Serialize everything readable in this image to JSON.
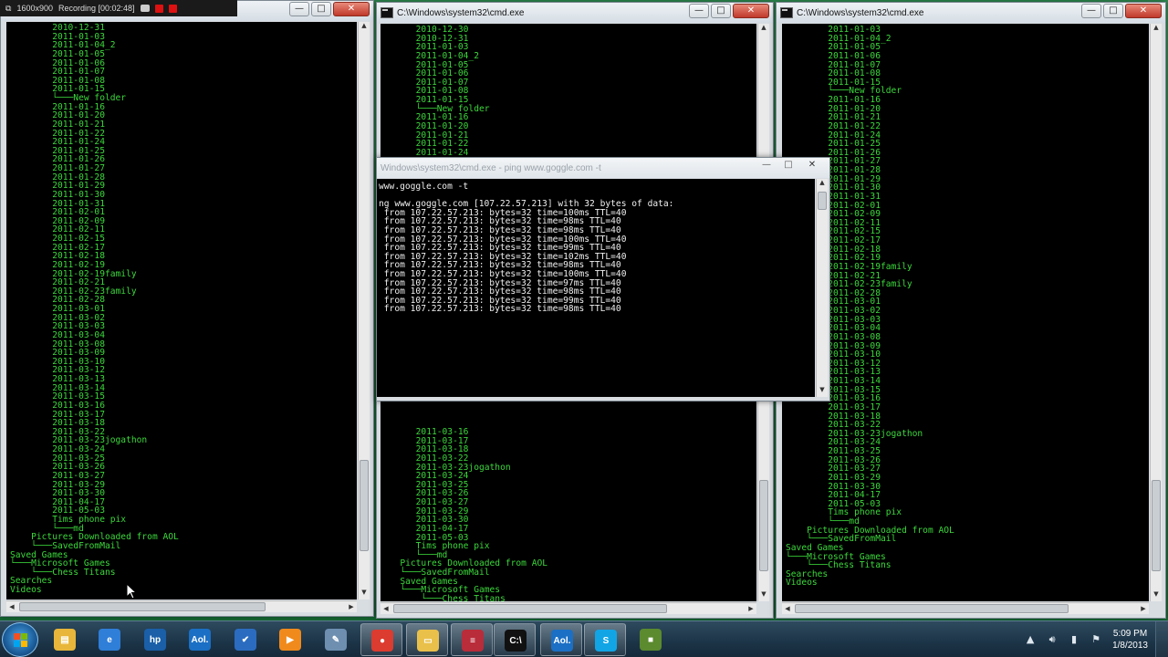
{
  "recording": {
    "resolution": "1600x900",
    "status": "Recording [00:02:48]"
  },
  "windows": {
    "left": {
      "title": "",
      "lines": [
        "        2010-12-31",
        "        2011-01-03",
        "        2011-01-04_2",
        "        2011-01-05",
        "        2011-01-06",
        "        2011-01-07",
        "        2011-01-08",
        "        2011-01-15",
        "        └───New folder",
        "        2011-01-16",
        "        2011-01-20",
        "        2011-01-21",
        "        2011-01-22",
        "        2011-01-24",
        "        2011-01-25",
        "        2011-01-26",
        "        2011-01-27",
        "        2011-01-28",
        "        2011-01-29",
        "        2011-01-30",
        "        2011-01-31",
        "        2011-02-01",
        "        2011-02-09",
        "        2011-02-11",
        "        2011-02-15",
        "        2011-02-17",
        "        2011-02-18",
        "        2011-02-19",
        "        2011-02-19family",
        "        2011-02-21",
        "        2011-02-23family",
        "        2011-02-28",
        "        2011-03-01",
        "        2011-03-02",
        "        2011-03-03",
        "        2011-03-04",
        "        2011-03-08",
        "        2011-03-09",
        "        2011-03-10",
        "        2011-03-12",
        "        2011-03-13",
        "        2011-03-14",
        "        2011-03-15",
        "        2011-03-16",
        "        2011-03-17",
        "        2011-03-18",
        "        2011-03-22",
        "        2011-03-23jogathon",
        "        2011-03-24",
        "        2011-03-25",
        "        2011-03-26",
        "        2011-03-27",
        "        2011-03-29",
        "        2011-03-30",
        "        2011-04-17",
        "        2011-05-03",
        "        Tims phone pix",
        "        └───md",
        "    Pictures Downloaded from AOL",
        "    └───SavedFromMail",
        "Saved Games",
        "└───Microsoft Games",
        "    └───Chess Titans",
        "Searches",
        "Videos"
      ]
    },
    "middle": {
      "title": "C:\\Windows\\system32\\cmd.exe",
      "lines_top": [
        "      2010-12-30",
        "      2010-12-31",
        "      2011-01-03",
        "      2011-01-04_2",
        "      2011-01-05",
        "      2011-01-06",
        "      2011-01-07",
        "      2011-01-08",
        "      2011-01-15",
        "      └───New folder",
        "      2011-01-16",
        "      2011-01-20",
        "      2011-01-21",
        "      2011-01-22",
        "      2011-01-24"
      ],
      "lines_bottom": [
        "      2011-03-16",
        "      2011-03-17",
        "      2011-03-18",
        "      2011-03-22",
        "      2011-03-23jogathon",
        "      2011-03-24",
        "      2011-03-25",
        "      2011-03-26",
        "      2011-03-27",
        "      2011-03-29",
        "      2011-03-30",
        "      2011-04-17",
        "      2011-05-03",
        "      Tims phone pix",
        "      └───md",
        "   Pictures Downloaded from AOL",
        "   └───SavedFromMail",
        "   Saved Games",
        "   └───Microsoft Games",
        "       └───Chess Titans",
        "   Searches",
        "   Videos"
      ]
    },
    "right": {
      "title": "C:\\Windows\\system32\\cmd.exe",
      "lines": [
        "        2011-01-03",
        "        2011-01-04_2",
        "        2011-01-05",
        "        2011-01-06",
        "        2011-01-07",
        "        2011-01-08",
        "        2011-01-15",
        "        └───New folder",
        "        2011-01-16",
        "        2011-01-20",
        "        2011-01-21",
        "        2011-01-22",
        "        2011-01-24",
        "        2011-01-25",
        "        2011-01-26",
        "        2011-01-27",
        "        2011-01-28",
        "        2011-01-29",
        "        2011-01-30",
        "        2011-01-31",
        "        2011-02-01",
        "        2011-02-09",
        "        2011-02-11",
        "        2011-02-15",
        "        2011-02-17",
        "        2011-02-18",
        "        2011-02-19",
        "        2011-02-19family",
        "        2011-02-21",
        "        2011-02-23family",
        "        2011-02-28",
        "        2011-03-01",
        "        2011-03-02",
        "        2011-03-03",
        "        2011-03-04",
        "        2011-03-08",
        "        2011-03-09",
        "        2011-03-10",
        "        2011-03-12",
        "        2011-03-13",
        "        2011-03-14",
        "        2011-03-15",
        "        2011-03-16",
        "        2011-03-17",
        "        2011-03-18",
        "        2011-03-22",
        "        2011-03-23jogathon",
        "        2011-03-24",
        "        2011-03-25",
        "        2011-03-26",
        "        2011-03-27",
        "        2011-03-29",
        "        2011-03-30",
        "        2011-04-17",
        "        2011-05-03",
        "        Tims phone pix",
        "        └───md",
        "    Pictures Downloaded from AOL",
        "    └───SavedFromMail",
        "Saved Games",
        "└───Microsoft Games",
        "    └───Chess Titans",
        "Searches",
        "Videos"
      ]
    },
    "ping": {
      "title": "Windows\\system32\\cmd.exe - ping  www.goggle.com -t",
      "lines": [
        "www.goggle.com -t",
        "",
        "ng www.goggle.com [107.22.57.213] with 32 bytes of data:",
        " from 107.22.57.213: bytes=32 time=100ms TTL=40",
        " from 107.22.57.213: bytes=32 time=98ms TTL=40",
        " from 107.22.57.213: bytes=32 time=98ms TTL=40",
        " from 107.22.57.213: bytes=32 time=100ms TTL=40",
        " from 107.22.57.213: bytes=32 time=99ms TTL=40",
        " from 107.22.57.213: bytes=32 time=102ms TTL=40",
        " from 107.22.57.213: bytes=32 time=98ms TTL=40",
        " from 107.22.57.213: bytes=32 time=100ms TTL=40",
        " from 107.22.57.213: bytes=32 time=97ms TTL=40",
        " from 107.22.57.213: bytes=32 time=98ms TTL=40",
        " from 107.22.57.213: bytes=32 time=99ms TTL=40",
        " from 107.22.57.213: bytes=32 time=98ms TTL=40"
      ]
    }
  },
  "taskbar": {
    "pinned": [
      {
        "name": "windows-explorer-icon",
        "label": "",
        "color": "#e8b63a",
        "glyph": "▤"
      },
      {
        "name": "internet-explorer-icon",
        "label": "",
        "color": "#2f7ed8",
        "glyph": "e"
      },
      {
        "name": "hp-icon",
        "label": "",
        "color": "#1a5fa8",
        "glyph": "hp"
      },
      {
        "name": "aol-icon",
        "label": "",
        "color": "#1b6fc4",
        "glyph": "Aol."
      },
      {
        "name": "checkmark-app-icon",
        "label": "",
        "color": "#2b6cc0",
        "glyph": "✔"
      },
      {
        "name": "media-player-icon",
        "label": "",
        "color": "#f08a1c",
        "glyph": "▶"
      },
      {
        "name": "paint-icon",
        "label": "",
        "color": "#6e8fb0",
        "glyph": "✎"
      },
      {
        "name": "chrome-icon",
        "label": "",
        "color": "#dc3b2f",
        "glyph": "●"
      },
      {
        "name": "folder-icon",
        "label": "",
        "color": "#e9c04a",
        "glyph": "▭"
      },
      {
        "name": "flag-app-icon",
        "label": "",
        "color": "#b92c3a",
        "glyph": "≡"
      },
      {
        "name": "cmd-icon",
        "label": "",
        "color": "#111111",
        "glyph": "C:\\"
      },
      {
        "name": "aol-mail-icon",
        "label": "",
        "color": "#1b6fc4",
        "glyph": "Aol."
      },
      {
        "name": "skype-icon",
        "label": "",
        "color": "#12a5e5",
        "glyph": "S"
      },
      {
        "name": "minecraft-icon",
        "label": "",
        "color": "#5b8a2f",
        "glyph": "■"
      }
    ],
    "time": "5:09 PM",
    "date": "1/8/2013"
  },
  "colors": {
    "console_green": "#3bd83b",
    "desktop": "#1e7a3e"
  }
}
